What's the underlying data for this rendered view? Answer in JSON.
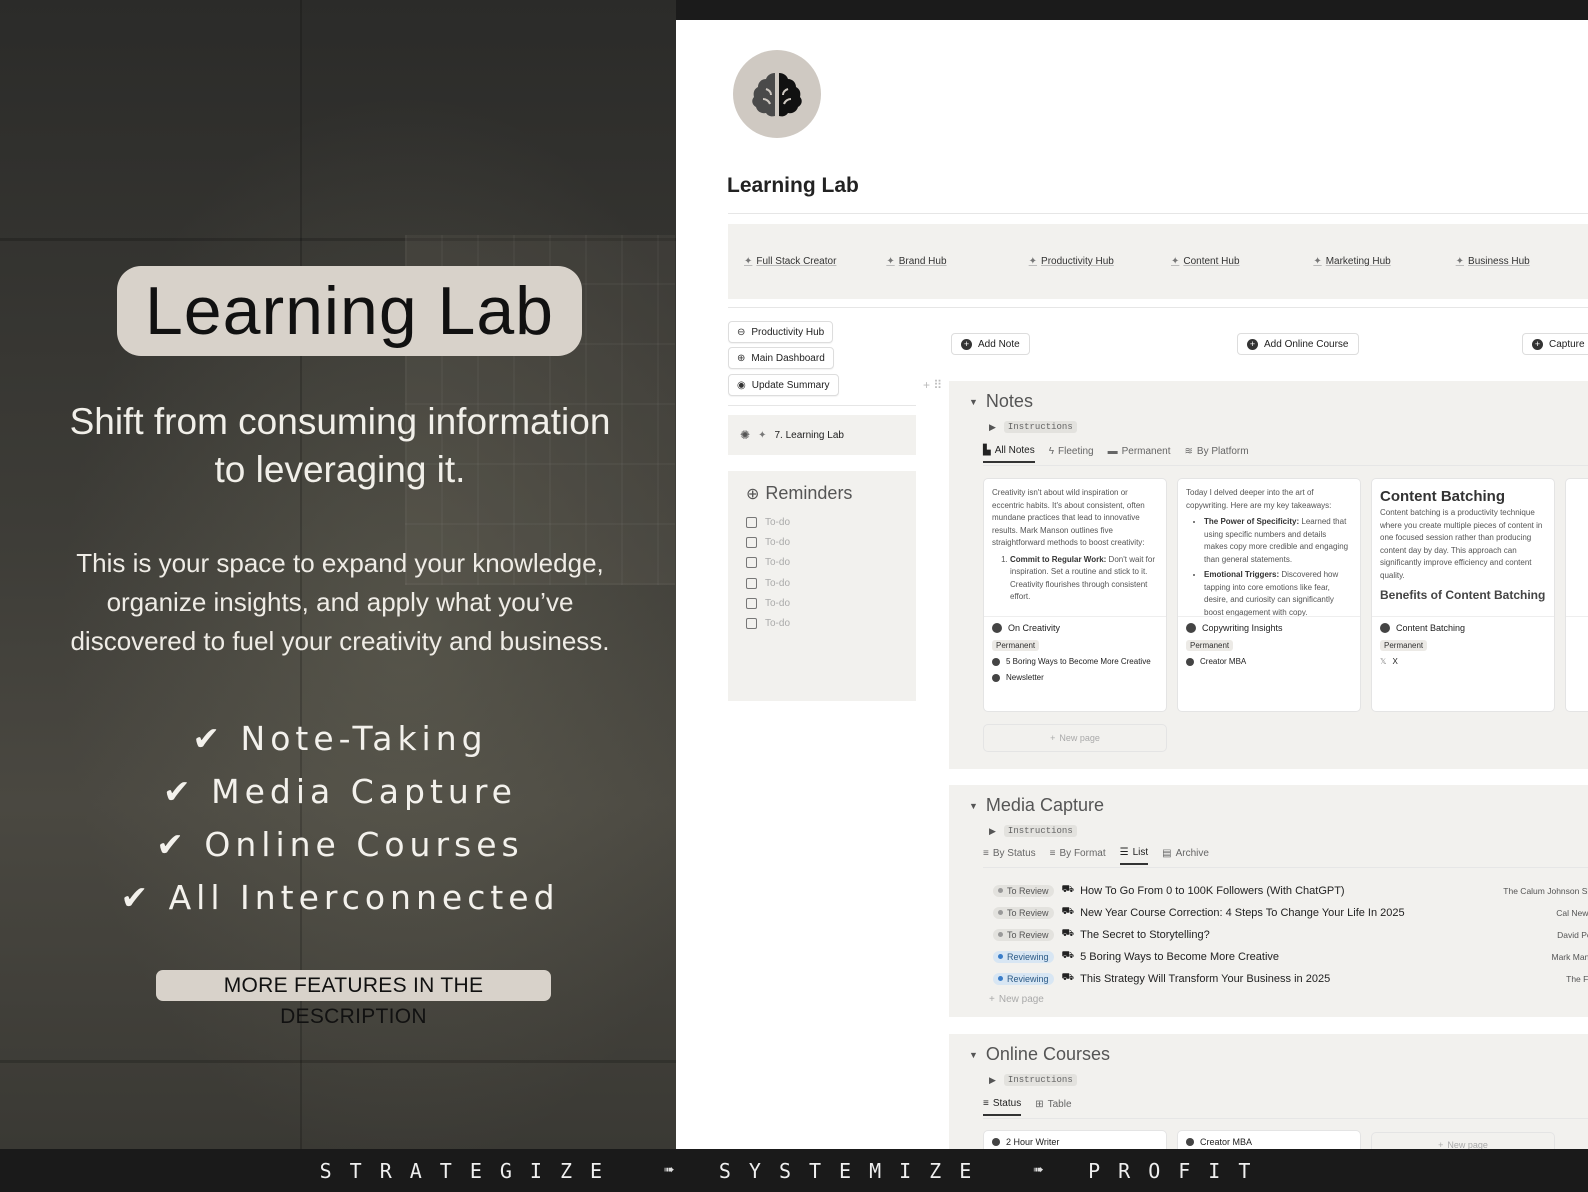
{
  "promo": {
    "title": "Learning Lab",
    "subtitle_line1": "Shift from consuming information",
    "subtitle_line2": "to leveraging it.",
    "desc_line1": "This is your space to expand your knowledge,",
    "desc_line2": "organize insights, and apply what you’ve",
    "desc_line3": "discovered to fuel your creativity and business.",
    "features": [
      "✔ Note-Taking",
      "✔ Media Capture",
      "✔ Online Courses",
      "✔ All Interconnected"
    ],
    "more_label": "MORE FEATURES IN THE DESCRIPTION"
  },
  "strip": {
    "words": [
      "STRATEGIZE",
      "SYSTEMIZE",
      "PROFIT"
    ],
    "arrow": "➠"
  },
  "page": {
    "title": "Learning Lab",
    "hubs": [
      "Full Stack Creator",
      "Brand Hub",
      "Productivity Hub",
      "Content Hub",
      "Marketing Hub",
      "Business Hub"
    ],
    "side_buttons": [
      "Productivity Hub",
      "Main Dashboard",
      "Update Summary"
    ],
    "breadcrumb": "7. Learning Lab",
    "reminders": {
      "title": "Reminders",
      "items": [
        "To-do",
        "To-do",
        "To-do",
        "To-do",
        "To-do",
        "To-do"
      ]
    },
    "actions": [
      "Add Note",
      "Add Online Course",
      "Capture"
    ]
  },
  "notes": {
    "title": "Notes",
    "instructions": "Instructions",
    "tabs": [
      "All Notes",
      "Fleeting",
      "Permanent",
      "By Platform"
    ],
    "cards": [
      {
        "preview": "Creativity isn't about wild inspiration or eccentric habits. It's about consistent, often mundane practices that lead to innovative results. Mark Manson outlines five straightforward methods to boost creativity:",
        "point_bold": "Commit to Regular Work:",
        "point_text": "Don't wait for inspiration. Set a routine and stick to it. Creativity flourishes through consistent effort.",
        "name": "On Creativity",
        "tag": "Permanent",
        "rel1": "5 Boring Ways to Become More Creative",
        "rel2": "Newsletter"
      },
      {
        "preview": "Today I delved deeper into the art of copywriting. Here are my key takeaways:",
        "point1_bold": "The Power of Specificity:",
        "point1_text": "Learned that using specific numbers and details makes copy more credible and engaging than general statements.",
        "point2_bold": "Emotional Triggers:",
        "point2_text": "Discovered how tapping into core emotions like fear, desire, and curiosity can significantly boost engagement with copy.",
        "name": "Copywriting Insights",
        "tag": "Permanent",
        "rel1": "Creator MBA"
      },
      {
        "heading": "Content Batching",
        "preview": "Content batching is a productivity technique where you create multiple pieces of content in one focused session rather than producing content day by day. This approach can significantly improve efficiency and content quality.",
        "subheading": "Benefits of Content Batching",
        "name": "Content Batching",
        "tag": "Permanent",
        "rel1": "X"
      }
    ],
    "new_page": "New page"
  },
  "media": {
    "title": "Media Capture",
    "instructions": "Instructions",
    "tabs": [
      "By Status",
      "By Format",
      "List",
      "Archive"
    ],
    "rows": [
      {
        "status": "To Review",
        "title": "How To Go From 0 to 100K Followers (With ChatGPT)",
        "author": "The Calum Johnson Show"
      },
      {
        "status": "To Review",
        "title": "New Year Course Correction: 4 Steps To Change Your Life In 2025",
        "author": "Cal Newport"
      },
      {
        "status": "To Review",
        "title": "The Secret to Storytelling?",
        "author": "David Perell"
      },
      {
        "status": "Reviewing",
        "title": "5 Boring Ways to Become More Creative",
        "author": "Mark Manson"
      },
      {
        "status": "Reviewing",
        "title": "This Strategy Will Transform Your Business in 2025",
        "author": "The Futur"
      }
    ],
    "new_page": "New page"
  },
  "courses": {
    "title": "Online Courses",
    "instructions": "Instructions",
    "tabs": [
      "Status",
      "Table"
    ],
    "cards": [
      "2 Hour Writer",
      "Creator MBA"
    ],
    "new_page": "New page"
  },
  "colors": {
    "accent_pill": "#d8d2ca",
    "reviewing": "#3a7dc9",
    "panel_bg": "#f2f1ee"
  }
}
